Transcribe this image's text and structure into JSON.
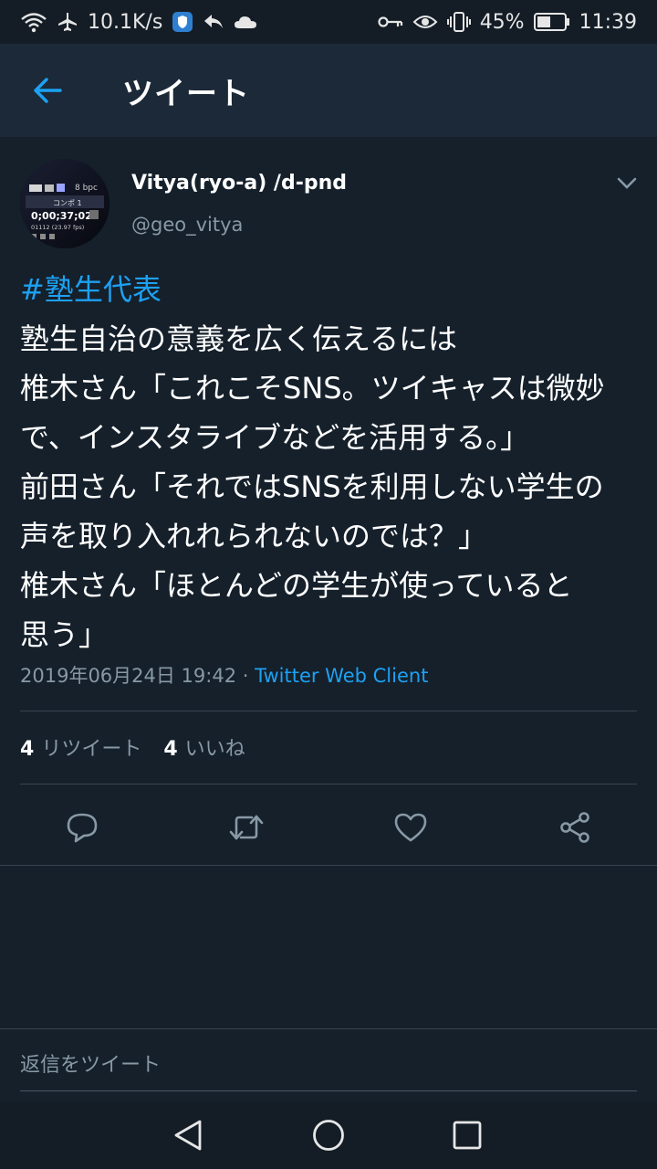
{
  "status_bar": {
    "speed": "10.1K/s",
    "battery": "45%",
    "time": "11:39",
    "icons_left": [
      "wifi-icon",
      "airplane-icon",
      "shield-icon",
      "reply-arrow-icon",
      "cloud-icon"
    ],
    "icons_right": [
      "key-icon",
      "eye-icon",
      "vibrate-icon",
      "battery-icon"
    ]
  },
  "app_bar": {
    "title": "ツイート"
  },
  "tweet": {
    "author_name": "Vitya(ryo-a) /d-pnd",
    "author_handle": "@geo_vitya",
    "hashtag": "#塾生代表",
    "lines": [
      "塾生自治の意義を広く伝えるには",
      "椎木さん「これこそSNS。ツイキャスは微妙",
      "で、インスタライブなどを活用する。」",
      "前田さん「それではSNSを利用しない学生の",
      "声を取り入れれられないのでは？」",
      "椎木さん「ほとんどの学生が使っていると",
      "思う」"
    ],
    "timestamp": "2019年06月24日 19:42",
    "separator": " · ",
    "client": "Twitter Web Client",
    "retweet_count": "4",
    "retweet_label": "リツイート",
    "like_count": "4",
    "like_label": "いいね",
    "avatar_text": {
      "bpc": "8 bpc",
      "comp": "コンポ 1",
      "timecode": "0;00;37;02",
      "frames": "01112 (23.97 fps)"
    }
  },
  "reply": {
    "placeholder": "返信をツイート"
  },
  "colors": {
    "background": "#15202b",
    "app_bar": "#1c2938",
    "accent": "#1da1f2",
    "muted": "#8899a6"
  }
}
